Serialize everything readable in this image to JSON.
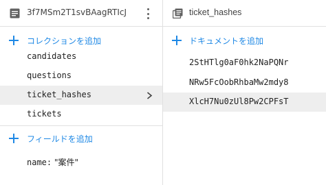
{
  "left_panel": {
    "title": "3f7MSm2T1svBAagRTIcJ",
    "header_icon": "document-icon",
    "menu_icon": "kebab-menu-icon",
    "add_collection_label": "コレクションを追加",
    "collections": [
      {
        "label": "candidates"
      },
      {
        "label": "questions"
      },
      {
        "label": "ticket_hashes",
        "selected": true
      },
      {
        "label": "tickets"
      }
    ],
    "add_field_label": "フィールドを追加",
    "fields": [
      {
        "name": "name:",
        "value": "\"案件\""
      }
    ]
  },
  "right_panel": {
    "title": "ticket_hashes",
    "header_icon": "collection-icon",
    "add_document_label": "ドキュメントを追加",
    "documents": [
      {
        "label": "2StHTlg0aF0hk2NaPQNr"
      },
      {
        "label": "NRw5FcOobRhbaMw2mdy8"
      },
      {
        "label": "XlcH7Nu0zUl8Pw2CPFsT",
        "selected": true
      }
    ]
  },
  "colors": {
    "accent": "#1e88e5",
    "selected_bg": "#eeeeee",
    "divider": "#e0e0e0",
    "text": "#212121"
  }
}
